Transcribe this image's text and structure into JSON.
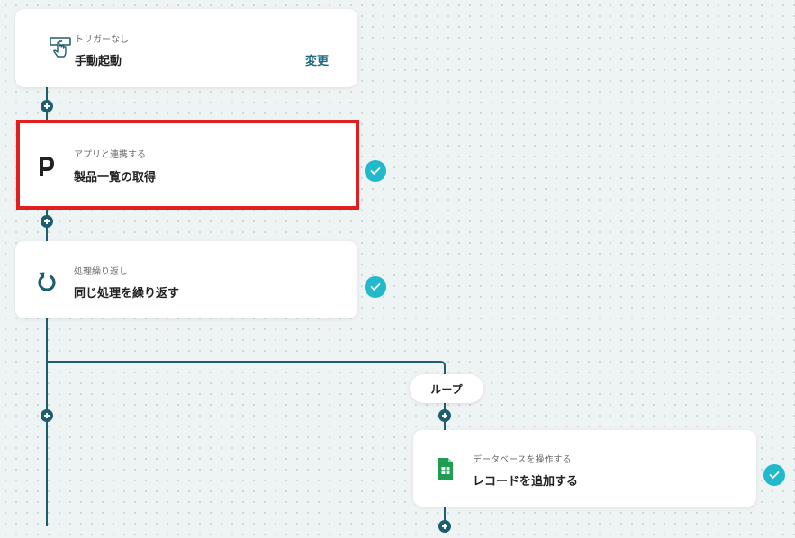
{
  "flow": {
    "trigger": {
      "subtitle": "トリガーなし",
      "title": "手動起動",
      "change_label": "変更",
      "icon": "hand-pointer-icon"
    },
    "steps": [
      {
        "subtitle": "アプリと連携する",
        "title": "製品一覧の取得",
        "icon": "p-app-logo-icon",
        "status": "completed"
      },
      {
        "subtitle": "処理繰り返し",
        "title": "同じ処理を繰り返す",
        "icon": "loop-arrow-icon",
        "status": "completed"
      }
    ],
    "loop": {
      "label": "ループ",
      "steps": [
        {
          "subtitle": "データベースを操作する",
          "title": "レコードを追加する",
          "icon": "google-sheets-icon",
          "status": "completed"
        }
      ]
    }
  },
  "colors": {
    "connector": "#1d5e6f",
    "check": "#22b9cc",
    "selected_outline": "#e02020",
    "link": "#1d6a82",
    "sheets_green": "#1e9e50"
  }
}
